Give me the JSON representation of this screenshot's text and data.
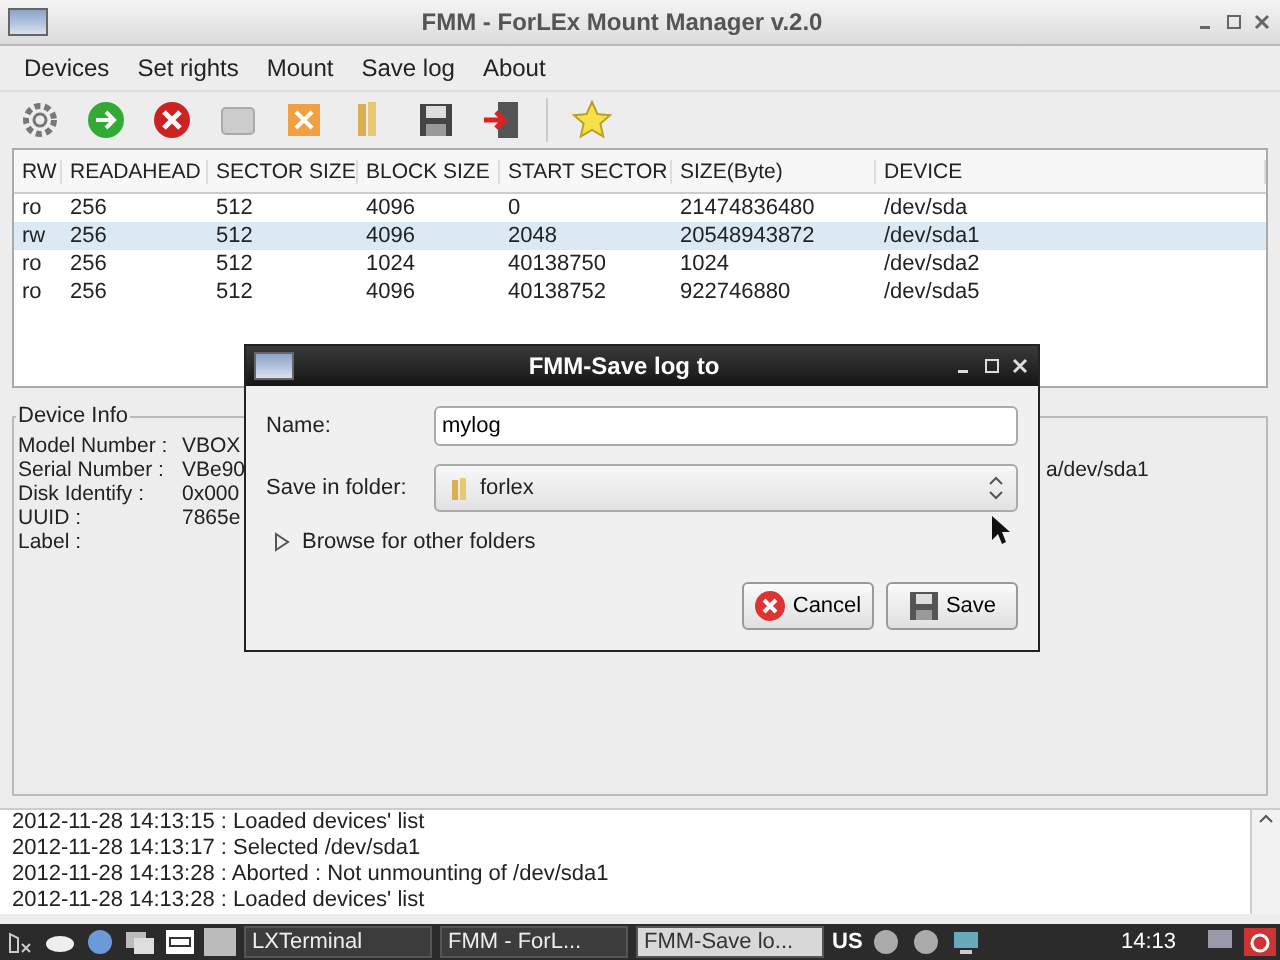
{
  "window": {
    "title": "FMM - ForLEx Mount Manager v.2.0"
  },
  "menu": [
    "Devices",
    "Set rights",
    "Mount",
    "Save log",
    "About"
  ],
  "table": {
    "columns": [
      "RW",
      "READAHEAD",
      "SECTOR SIZE",
      "BLOCK SIZE",
      "START SECTOR",
      "SIZE(Byte)",
      "DEVICE"
    ],
    "rows": [
      {
        "cells": [
          "ro",
          "256",
          "512",
          "4096",
          "0",
          "21474836480",
          "/dev/sda"
        ],
        "selected": false
      },
      {
        "cells": [
          "rw",
          "256",
          "512",
          "4096",
          "2048",
          "20548943872",
          "/dev/sda1"
        ],
        "selected": true
      },
      {
        "cells": [
          "ro",
          "256",
          "512",
          "1024",
          "40138750",
          "1024",
          "/dev/sda2"
        ],
        "selected": false
      },
      {
        "cells": [
          "ro",
          "256",
          "512",
          "4096",
          "40138752",
          "922746880",
          "/dev/sda5"
        ],
        "selected": false
      }
    ]
  },
  "device_info": {
    "title": "Device Info",
    "rows": [
      {
        "label": "Model Number :",
        "value": "VBOX"
      },
      {
        "label": "Serial Number :",
        "value": "VBe90",
        "tail": "a/dev/sda1"
      },
      {
        "label": "Disk Identify :",
        "value": "0x000"
      },
      {
        "label": "UUID :",
        "value": "7865e"
      },
      {
        "label": "Label :"
      }
    ]
  },
  "log": [
    "2012-11-28 14:13:15 : Loaded devices' list",
    "2012-11-28 14:13:17 : Selected /dev/sda1",
    "2012-11-28 14:13:28 : Aborted : Not unmounting of /dev/sda1",
    "2012-11-28 14:13:28 : Loaded devices' list"
  ],
  "dialog": {
    "title": "FMM-Save log to",
    "name_label": "Name:",
    "name_value": "mylog",
    "folder_label": "Save in folder:",
    "folder": "forlex",
    "browse": "Browse for other folders",
    "expanded": false,
    "buttons": [
      {
        "kind": "cancel",
        "label": "Cancel"
      },
      {
        "kind": "save",
        "label": "Save"
      }
    ]
  },
  "taskbar": {
    "tasks": [
      {
        "label": "LXTerminal",
        "selected": false
      },
      {
        "label": "FMM - ForL...",
        "selected": false
      },
      {
        "label": "FMM-Save lo...",
        "selected": true
      }
    ],
    "layout": "US",
    "clock": "14:13"
  }
}
